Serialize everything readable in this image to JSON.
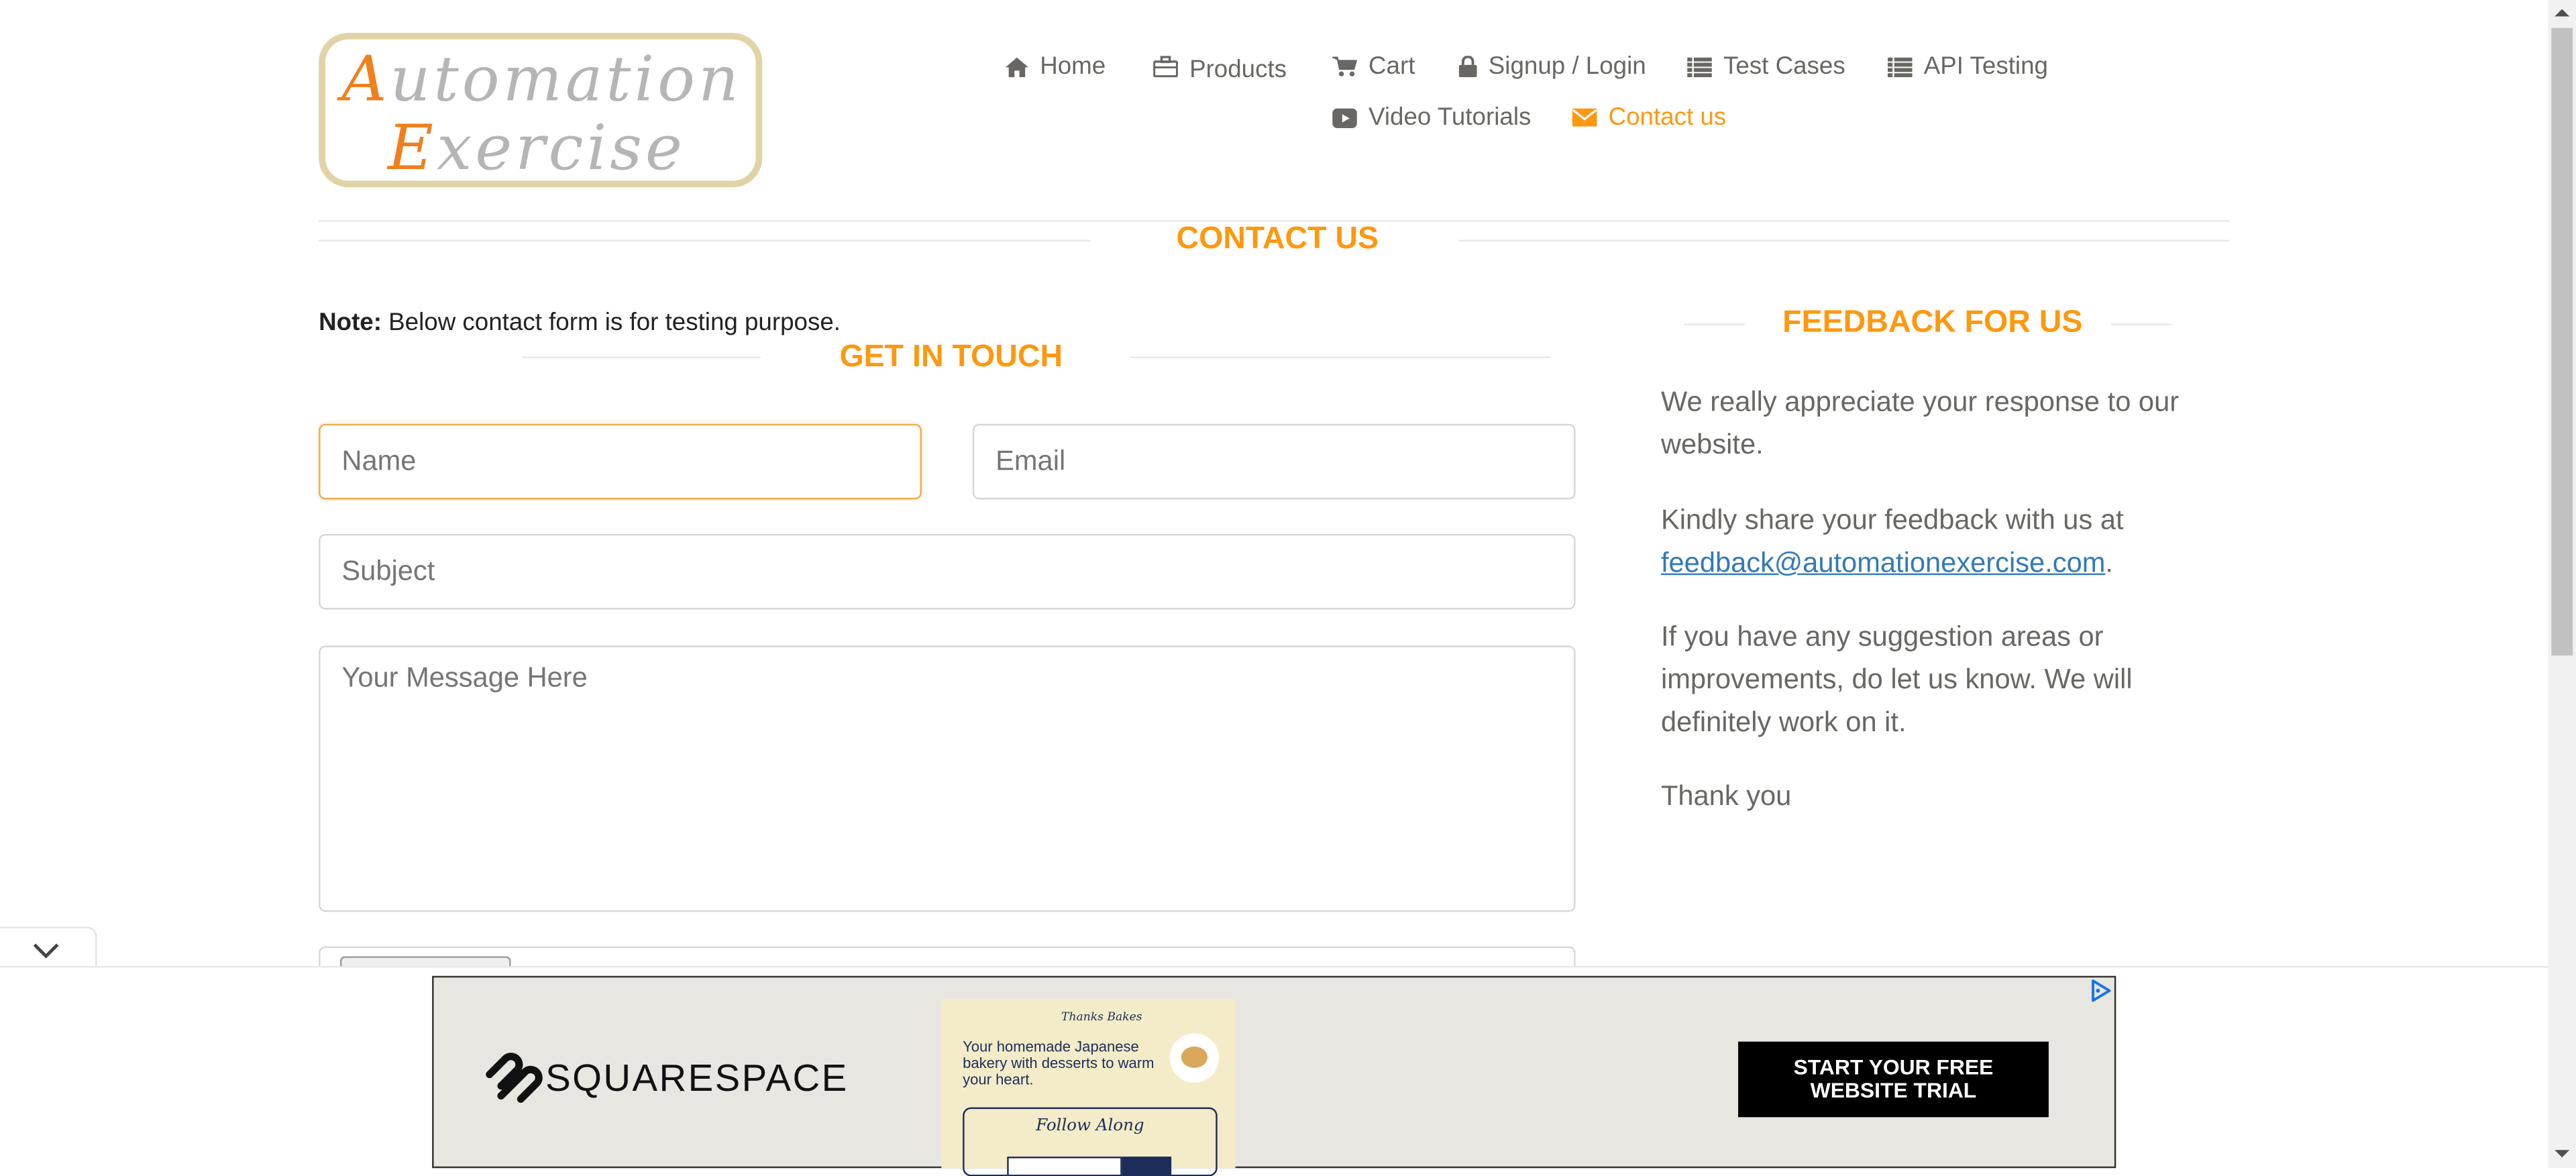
{
  "header": {
    "logo": {
      "word1": "Automation",
      "word2": "Exercise"
    },
    "nav": [
      {
        "label": "Home",
        "icon": "home-icon"
      },
      {
        "label": "Products",
        "icon": "briefcase-icon"
      },
      {
        "label": "Cart",
        "icon": "cart-icon"
      },
      {
        "label": "Signup / Login",
        "icon": "lock-icon"
      },
      {
        "label": "Test Cases",
        "icon": "list-icon"
      },
      {
        "label": "API Testing",
        "icon": "list-icon"
      },
      {
        "label": "Video Tutorials",
        "icon": "youtube-play-icon"
      },
      {
        "label": "Contact us",
        "icon": "envelope-icon",
        "active": true
      }
    ]
  },
  "page": {
    "title": "CONTACT US",
    "note_bold": "Note:",
    "note_text": " Below contact form is for testing purpose."
  },
  "form": {
    "title": "GET IN TOUCH",
    "name_placeholder": "Name",
    "email_placeholder": "Email",
    "subject_placeholder": "Subject",
    "message_placeholder": "Your Message Here"
  },
  "feedback": {
    "title": "FEEDBACK FOR US",
    "p1": "We really appreciate your response to our website.",
    "p2_prefix": "Kindly share your feedback with us at ",
    "email": "feedback@automationexercise.com",
    "p2_suffix": ".",
    "p3": "If you have any suggestion areas or improvements, do let us know. We will definitely work on it.",
    "p4": "Thank you"
  },
  "ad": {
    "brand": "SQUARESPACE",
    "cta": "START YOUR FREE WEBSITE TRIAL",
    "mock_site_name": "Thanks Bakes",
    "mock_headline": "Your homemade Japanese bakery with desserts to warm your heart.",
    "mock_follow": "Follow Along"
  },
  "colors": {
    "accent": "#fe980f",
    "text": "#696763",
    "link": "#337ab7"
  }
}
